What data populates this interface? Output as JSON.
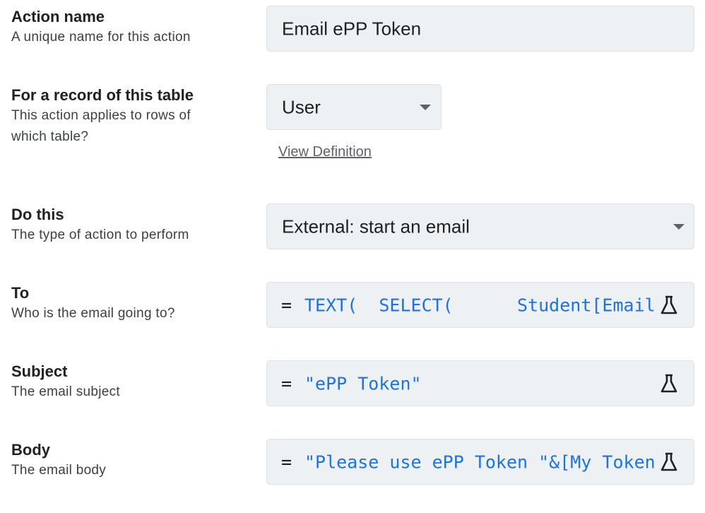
{
  "action_name": {
    "title": "Action name",
    "desc": "A unique name for this action",
    "value": "Email ePP Token"
  },
  "table": {
    "title": "For a record of this table",
    "desc_line1": "This action applies to rows of",
    "desc_line2": "which table?",
    "value": "User",
    "link": "View Definition"
  },
  "do_this": {
    "title": "Do this",
    "desc": "The type of action to perform",
    "value": "External: start an email"
  },
  "to": {
    "title": "To",
    "desc": "Who is the email going to?",
    "eq": "=",
    "code": "TEXT(  SELECT(      Student[Email]"
  },
  "subject": {
    "title": "Subject",
    "desc": "The email subject",
    "eq": "=",
    "code": "\"ePP Token\""
  },
  "body": {
    "title": "Body",
    "desc": "The email body",
    "eq": "=",
    "code": "\"Please use ePP Token \"&[My Token]"
  },
  "icons": {
    "dropdown": "chevron-down-icon",
    "formula": "flask-icon"
  },
  "colors": {
    "field_bg": "#eef1f3",
    "code": "#1a73e8"
  }
}
